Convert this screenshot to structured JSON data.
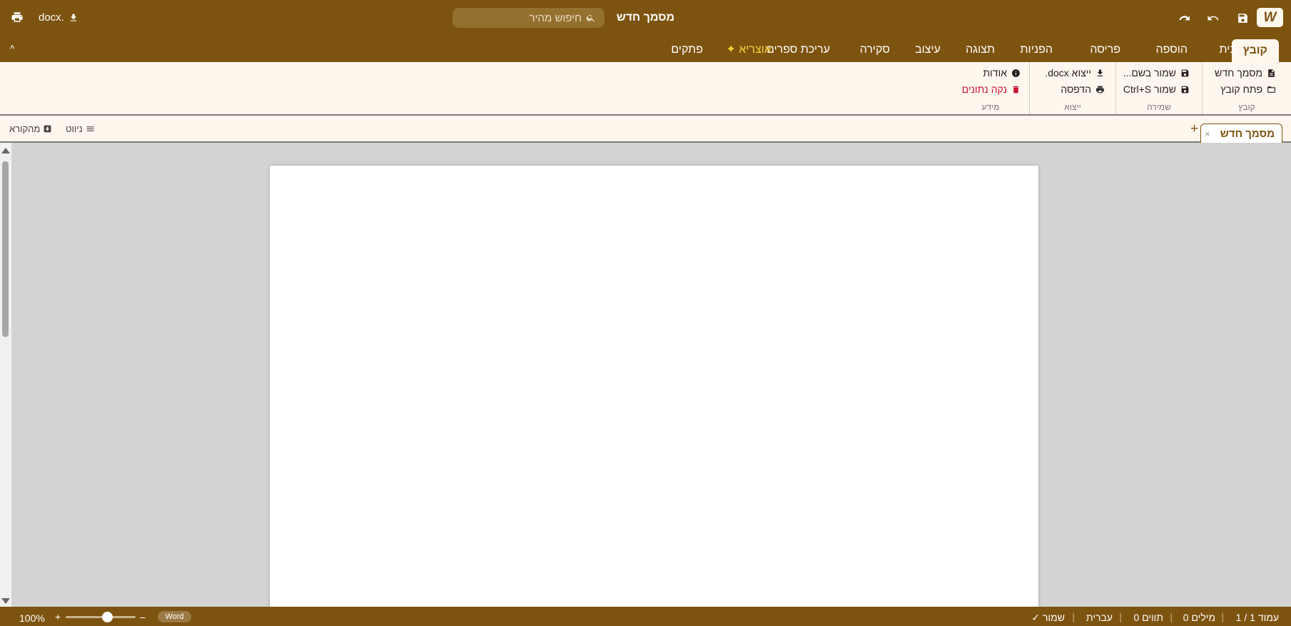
{
  "app": {
    "logo": "W"
  },
  "titlebar": {
    "doc_title": "מסמך חדש",
    "search_placeholder": "חיפוש מהיר",
    "export_label": "docx."
  },
  "tabs": [
    "קובץ",
    "בית",
    "הוספה",
    "פריסה",
    "הפניות",
    "תצוגה",
    "עיצוב",
    "סקירה",
    "עריכת ספרים",
    "✦ אוצריא",
    "פתקים"
  ],
  "collapse_label": "^",
  "ribbon": {
    "groups": {
      "file": {
        "name": "קובץ",
        "new_doc": "מסמך חדש",
        "open_file": "פתח קובץ"
      },
      "save": {
        "name": "שמירה",
        "save_as": "שמור בשם...",
        "save": "שמור Ctrl+S"
      },
      "export": {
        "name": "ייצוא",
        "export_docx": "ייצוא docx.",
        "print": "הדפסה"
      },
      "info": {
        "name": "מידע",
        "about": "אודות",
        "clear_data": "נקה נתונים"
      }
    }
  },
  "doc_tabs": [
    {
      "label": "מסמך חדש",
      "close": "×"
    }
  ],
  "add_tab": "+",
  "nav": {
    "navigation": "ניווט",
    "from_reader": "מהקורא"
  },
  "status": {
    "page": "עמוד 1 / 1",
    "words": "0 מילים",
    "chars": "0 תווים",
    "language": "עברית",
    "saved": "✓ שמור",
    "zoom": "100%",
    "zoom_in": "+",
    "zoom_out": "–",
    "mode_badge": "Word",
    "zoom_level": 0.6
  },
  "colors": {
    "brand": "#7d5310",
    "ribbon_bg": "#fff6ee",
    "special_tab": "#f5d43a",
    "danger": "#c8102e"
  }
}
